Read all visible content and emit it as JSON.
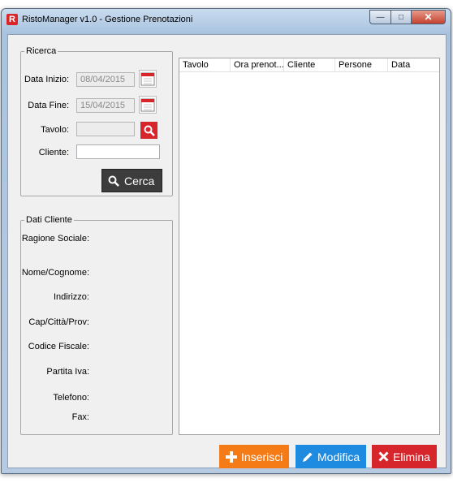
{
  "window": {
    "title": "RistoManager v1.0 - Gestione Prenotazioni",
    "app_icon_letter": "R"
  },
  "ricerca": {
    "legend": "Ricerca",
    "data_inizio_label": "Data Inizio:",
    "data_inizio_value": "08/04/2015",
    "data_fine_label": "Data Fine:",
    "data_fine_value": "15/04/2015",
    "tavolo_label": "Tavolo:",
    "tavolo_value": "",
    "cliente_label": "Cliente:",
    "cliente_value": "",
    "cerca_label": "Cerca"
  },
  "dati_cliente": {
    "legend": "Dati Cliente",
    "fields": [
      "Ragione Sociale:",
      "Nome/Cognome:",
      "Indirizzo:",
      "Cap/Città/Prov:",
      "Codice Fiscale:",
      "Partita Iva:",
      "Telefono:",
      "Fax:"
    ]
  },
  "table": {
    "columns": [
      "Tavolo",
      "Ora prenot...",
      "Cliente",
      "Persone",
      "Data"
    ],
    "rows": []
  },
  "actions": {
    "inserisci": "Inserisci",
    "modifica": "Modifica",
    "elimina": "Elimina"
  },
  "colors": {
    "inserisci": "#f47b16",
    "modifica": "#1e8ae0",
    "elimina": "#d7262b",
    "cerca": "#3c3c3c"
  }
}
